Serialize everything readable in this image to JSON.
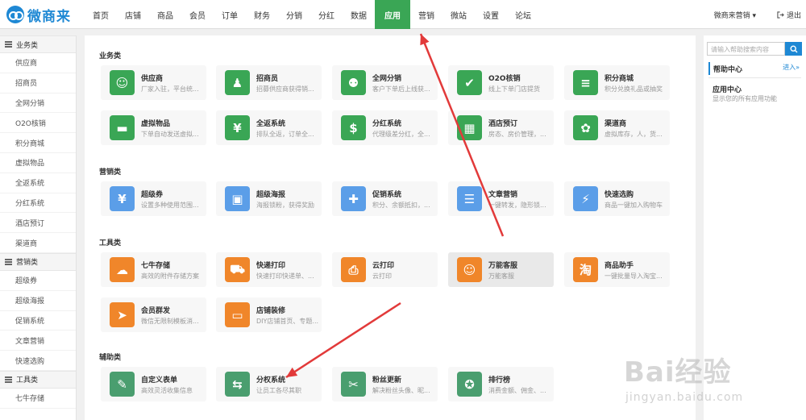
{
  "brand": {
    "name": "微商来",
    "color": "#1e88d4"
  },
  "nav": {
    "items": [
      "首页",
      "店铺",
      "商品",
      "会员",
      "订单",
      "财务",
      "分销",
      "分红",
      "数据",
      "应用",
      "营销",
      "微站",
      "设置",
      "论坛"
    ],
    "active": "应用",
    "active_color": "#3aa655",
    "user": "微商来营销",
    "logout": "退出"
  },
  "sidebar": {
    "groups": [
      {
        "title": "业务类",
        "items": [
          "供应商",
          "招商员",
          "全网分销",
          "O2O核销",
          "积分商城",
          "虚拟物品",
          "全返系统",
          "分红系统",
          "酒店预订",
          "渠道商"
        ]
      },
      {
        "title": "营销类",
        "items": [
          "超级券",
          "超级海报",
          "促销系统",
          "文章营销",
          "快速选购"
        ]
      },
      {
        "title": "工具类",
        "items": [
          "七牛存储"
        ]
      }
    ]
  },
  "sections": [
    {
      "title": "业务类",
      "cards": [
        {
          "title": "供应商",
          "desc": "厂家入驻，平台统...",
          "icon": "supplier-icon",
          "glyph": "☺",
          "color": "#3aa655"
        },
        {
          "title": "招商员",
          "desc": "招募供应商获得销...",
          "icon": "recruiter-icon",
          "glyph": "♟",
          "color": "#3aa655"
        },
        {
          "title": "全网分销",
          "desc": "客户下单后上线获...",
          "icon": "distribution-icon",
          "glyph": "⚉",
          "color": "#3aa655"
        },
        {
          "title": "O2O核销",
          "desc": "线上下单门店提货",
          "icon": "o2o-icon",
          "glyph": "✔",
          "color": "#3aa655"
        },
        {
          "title": "积分商城",
          "desc": "积分兑换礼品或抽奖",
          "icon": "points-mall-icon",
          "glyph": "≡",
          "color": "#3aa655"
        },
        {
          "title": "虚拟物品",
          "desc": "下单自动发送虚拟...",
          "icon": "virtual-goods-icon",
          "glyph": "▬",
          "color": "#3aa655"
        },
        {
          "title": "全返系统",
          "desc": "排队全返，订单全...",
          "icon": "full-return-icon",
          "glyph": "¥",
          "color": "#3aa655"
        },
        {
          "title": "分红系统",
          "desc": "代理级差分红，全...",
          "icon": "dividend-icon",
          "glyph": "$",
          "color": "#3aa655"
        },
        {
          "title": "酒店预订",
          "desc": "房态、房价管理，...",
          "icon": "hotel-icon",
          "glyph": "▦",
          "color": "#3aa655"
        },
        {
          "title": "渠道商",
          "desc": "虚拟库存，人，货...",
          "icon": "channel-icon",
          "glyph": "✿",
          "color": "#3aa655"
        }
      ]
    },
    {
      "title": "营销类",
      "cards": [
        {
          "title": "超级券",
          "desc": "设置多种使用范围...",
          "icon": "coupon-icon",
          "glyph": "¥",
          "color": "#5b9ee8"
        },
        {
          "title": "超级海报",
          "desc": "海报锁粉，获得奖励",
          "icon": "poster-icon",
          "glyph": "▣",
          "color": "#5b9ee8"
        },
        {
          "title": "促销系统",
          "desc": "积分、余额抵扣，...",
          "icon": "promotion-icon",
          "glyph": "✚",
          "color": "#5b9ee8"
        },
        {
          "title": "文章营销",
          "desc": "一键转发，隐形锁...",
          "icon": "article-icon",
          "glyph": "☰",
          "color": "#5b9ee8"
        },
        {
          "title": "快速选购",
          "desc": "商品一键加入购物车",
          "icon": "quick-buy-icon",
          "glyph": "⚡",
          "color": "#5b9ee8"
        }
      ]
    },
    {
      "title": "工具类",
      "cards": [
        {
          "title": "七牛存储",
          "desc": "高效的附件存储方案",
          "icon": "cloud-storage-icon",
          "glyph": "☁",
          "color": "#f0862a"
        },
        {
          "title": "快递打印",
          "desc": "快速打印快递单、...",
          "icon": "express-print-icon",
          "glyph": "⛟",
          "color": "#f0862a"
        },
        {
          "title": "云打印",
          "desc": "云打印",
          "icon": "cloud-print-icon",
          "glyph": "⎙",
          "color": "#f0862a"
        },
        {
          "title": "万能客服",
          "desc": "万能客服",
          "icon": "customer-service-icon",
          "glyph": "☺",
          "color": "#f0862a",
          "highlight": true
        },
        {
          "title": "商品助手",
          "desc": "一键批量导入淘宝...",
          "icon": "product-helper-icon",
          "glyph": "淘",
          "color": "#f0862a"
        },
        {
          "title": "会员群发",
          "desc": "微信无限制模板消...",
          "icon": "mass-message-icon",
          "glyph": "➤",
          "color": "#f0862a"
        },
        {
          "title": "店铺装修",
          "desc": "DIY店铺首页、专题...",
          "icon": "decoration-icon",
          "glyph": "▭",
          "color": "#f0862a"
        }
      ]
    },
    {
      "title": "辅助类",
      "cards": [
        {
          "title": "自定义表单",
          "desc": "高效灵活收集信息",
          "icon": "custom-form-icon",
          "glyph": "✎",
          "color": "#4a9e6f"
        },
        {
          "title": "分权系统",
          "desc": "让员工各尽其职",
          "icon": "permission-icon",
          "glyph": "⇆",
          "color": "#4a9e6f"
        },
        {
          "title": "粉丝更新",
          "desc": "解决粉丝头像、昵...",
          "icon": "fans-update-icon",
          "glyph": "✂",
          "color": "#4a9e6f"
        },
        {
          "title": "排行榜",
          "desc": "消费金额、佣金、...",
          "icon": "ranking-icon",
          "glyph": "✪",
          "color": "#4a9e6f"
        }
      ]
    }
  ],
  "right": {
    "search_placeholder": "请输入帮助搜索内容",
    "help_title": "帮助中心",
    "help_more": "进入»",
    "item_title": "应用中心",
    "item_desc": "显示您的所有应用功能"
  },
  "watermark": {
    "main": "Bai经验",
    "sub": "jingyan.baidu.com"
  },
  "annotation_color": "#e23a3a"
}
